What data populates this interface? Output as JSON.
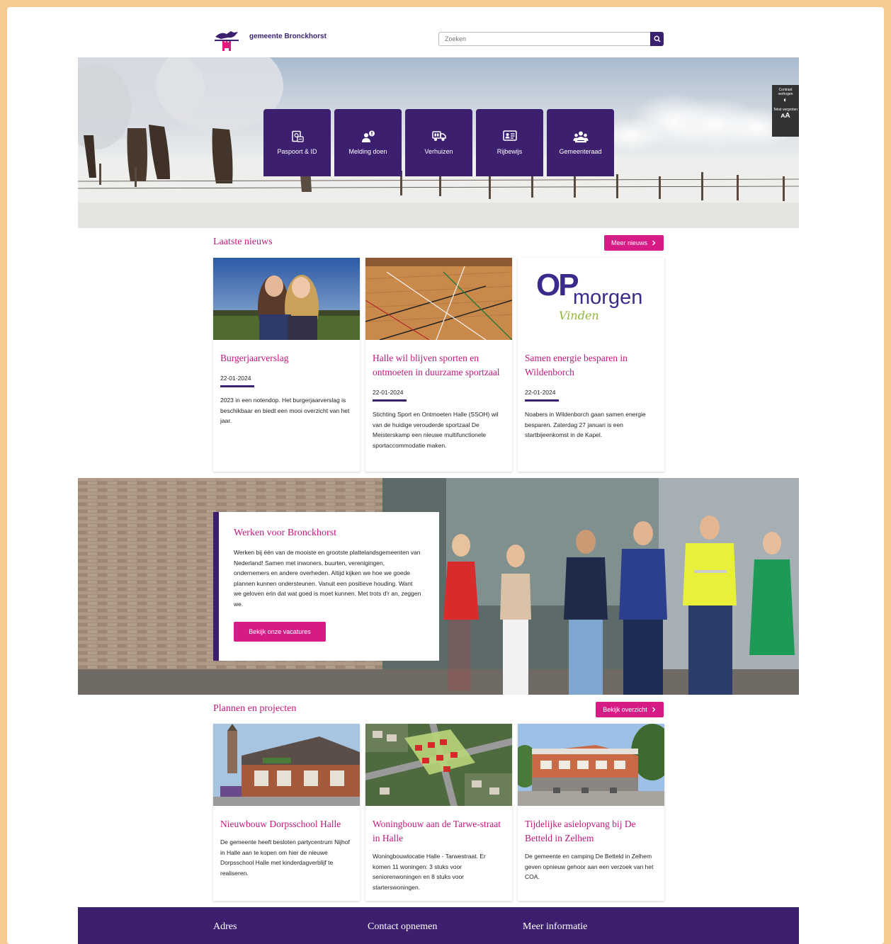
{
  "header": {
    "brand": "gemeente Bronckhorst",
    "search_placeholder": "Zoeken"
  },
  "quick_links": [
    {
      "label": "Paspoort & ID",
      "icon": "passport-icon"
    },
    {
      "label": "Melding doen",
      "icon": "report-icon"
    },
    {
      "label": "Verhuizen",
      "icon": "moving-truck-icon"
    },
    {
      "label": "Rijbewijs",
      "icon": "driving-license-icon"
    },
    {
      "label": "Gemeenteraad",
      "icon": "council-icon"
    }
  ],
  "accessibility": {
    "contrast_label": "Contrast verhogen",
    "contrast_glyph": "◐",
    "text_label": "Tekst vergroten",
    "text_glyph": "ᴀA"
  },
  "news": {
    "title": "Laatste nieuws",
    "more_button": "Meer nieuws",
    "items": [
      {
        "title": "Burgerjaarverslag",
        "date": "22-01-2024",
        "text": "2023 in een notendop. Het burgerjaarverslag is beschikbaar en biedt een mooi overzicht van het jaar."
      },
      {
        "title": "Halle wil blijven sporten en ontmoeten in duurzame sportzaal",
        "date": "22-01-2024",
        "text": "Stichting Sport en Ontmoeten Halle (SSOH) wil van de huidige verouderde sportzaal De Meisterskamp een nieuwe multifunctionele sportaccommodatie maken."
      },
      {
        "title": "Samen energie besparen in Wildenborch",
        "date": "22-01-2024",
        "text": "Noabers in Wildenborch gaan samen energie besparen. Zaterdag 27 januari is een startbijeenkomst in de Kapel."
      }
    ],
    "logo_text_big": "OP",
    "logo_text_word": "morgen",
    "logo_text_script": "Vinden"
  },
  "werken": {
    "title": "Werken voor Bronckhorst",
    "text": "Werken bij één van de mooiste en grootste plattelandsgemeenten van Nederland! Samen met inwoners, buurten, verenigingen, ondernemers en andere overheden. Altijd kijken we hoe we goede plannen kunnen ondersteunen. Vanuit een positieve houding. Want we geloven erin dat wat goed is moet kunnen. Met trots d'r an, zeggen we.",
    "button": "Bekijk onze vacatures"
  },
  "projects": {
    "title": "Plannen en projecten",
    "more_button": "Bekijk overzicht",
    "items": [
      {
        "title": "Nieuwbouw Dorpsschool Halle",
        "text": "De gemeente heeft besloten partycentrum Nijhof in Halle aan te kopen om hier de nieuwe Dorpsschool Halle met kinderdagverblijf te realiseren."
      },
      {
        "title": "Woningbouw aan de Tarwe-straat in Halle",
        "text": "Woningbouwlocatie Halle - Tarwestraat. Er komen 11 woningen: 3 stuks voor seniorenwoningen en 8 stuks voor starterswoningen."
      },
      {
        "title": "Tijdelijke asielopvang bij De Betteld in Zelhem",
        "text": "De gemeente en camping De Betteld in Zelhem geven opnieuw gehoor aan een verzoek van het COA."
      }
    ]
  },
  "footer": {
    "col1": "Adres",
    "col2": "Contact opnemen",
    "col3": "Meer informatie"
  },
  "colors": {
    "purple": "#3d1f70",
    "pink": "#d61a86",
    "heading_pink": "#c2177d",
    "frame": "#f5cb92"
  }
}
